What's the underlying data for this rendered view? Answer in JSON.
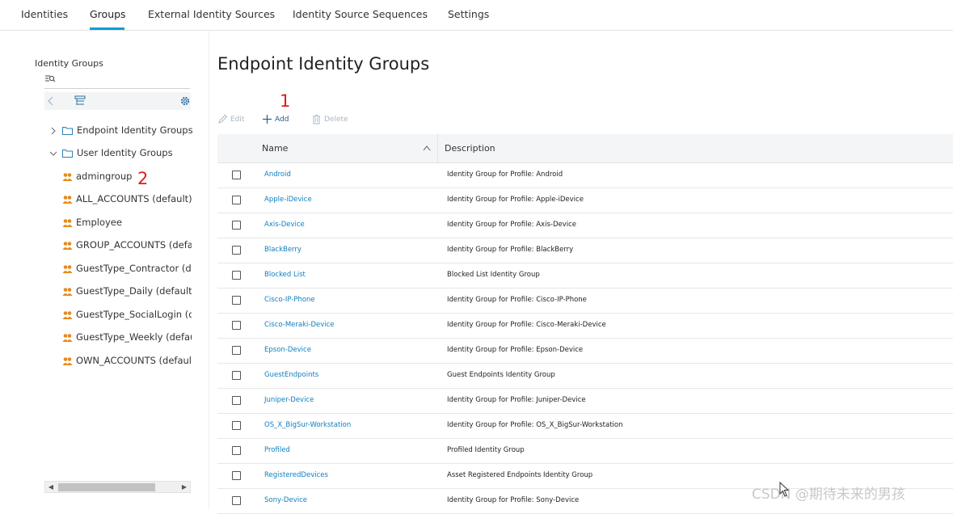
{
  "topnav": {
    "tabs": [
      {
        "label": "Identities"
      },
      {
        "label": "Groups",
        "active": true
      },
      {
        "label": "External Identity Sources"
      },
      {
        "label": "Identity Source Sequences"
      },
      {
        "label": "Settings"
      }
    ],
    "accent_color": "#049fd9"
  },
  "sidebar": {
    "title": "Identity Groups",
    "search_placeholder": "",
    "toolbar_icons": [
      "back-arrow-icon",
      "tree-list-icon",
      "gear-icon"
    ],
    "tree": [
      {
        "label": "Endpoint Identity Groups",
        "expanded": false,
        "icon": "folder-icon"
      },
      {
        "label": "User Identity Groups",
        "expanded": true,
        "icon": "folder-icon",
        "children": [
          {
            "label": "admingroup"
          },
          {
            "label": "ALL_ACCOUNTS (default)"
          },
          {
            "label": "Employee"
          },
          {
            "label": "GROUP_ACCOUNTS (default)"
          },
          {
            "label": "GuestType_Contractor (default)"
          },
          {
            "label": "GuestType_Daily (default)"
          },
          {
            "label": "GuestType_SocialLogin (default)"
          },
          {
            "label": "GuestType_Weekly (default)"
          },
          {
            "label": "OWN_ACCOUNTS (default)"
          }
        ]
      }
    ]
  },
  "main": {
    "title": "Endpoint Identity Groups",
    "actions": {
      "edit": "Edit",
      "add": "Add",
      "delete": "Delete"
    },
    "table": {
      "columns": [
        "Name",
        "Description"
      ],
      "rows": [
        {
          "name": "Android",
          "description": "Identity Group for Profile: Android"
        },
        {
          "name": "Apple-iDevice",
          "description": "Identity Group for Profile: Apple-iDevice"
        },
        {
          "name": "Axis-Device",
          "description": "Identity Group for Profile: Axis-Device"
        },
        {
          "name": "BlackBerry",
          "description": "Identity Group for Profile: BlackBerry"
        },
        {
          "name": "Blocked List",
          "description": "Blocked List Identity Group"
        },
        {
          "name": "Cisco-IP-Phone",
          "description": "Identity Group for Profile: Cisco-IP-Phone"
        },
        {
          "name": "Cisco-Meraki-Device",
          "description": "Identity Group for Profile: Cisco-Meraki-Device"
        },
        {
          "name": "Epson-Device",
          "description": "Identity Group for Profile: Epson-Device"
        },
        {
          "name": "GuestEndpoints",
          "description": "Guest Endpoints Identity Group"
        },
        {
          "name": "Juniper-Device",
          "description": "Identity Group for Profile: Juniper-Device"
        },
        {
          "name": "OS_X_BigSur-Workstation",
          "description": "Identity Group for Profile: OS_X_BigSur-Workstation"
        },
        {
          "name": "Profiled",
          "description": "Profiled Identity Group"
        },
        {
          "name": "RegisteredDevices",
          "description": "Asset Registered Endpoints Identity Group"
        },
        {
          "name": "Sony-Device",
          "description": "Identity Group for Profile: Sony-Device"
        }
      ]
    }
  },
  "annotations": {
    "marker_1": "1",
    "marker_2": "2",
    "color": "#e31b1b"
  },
  "watermark": "CSDN @期待未来的男孩"
}
